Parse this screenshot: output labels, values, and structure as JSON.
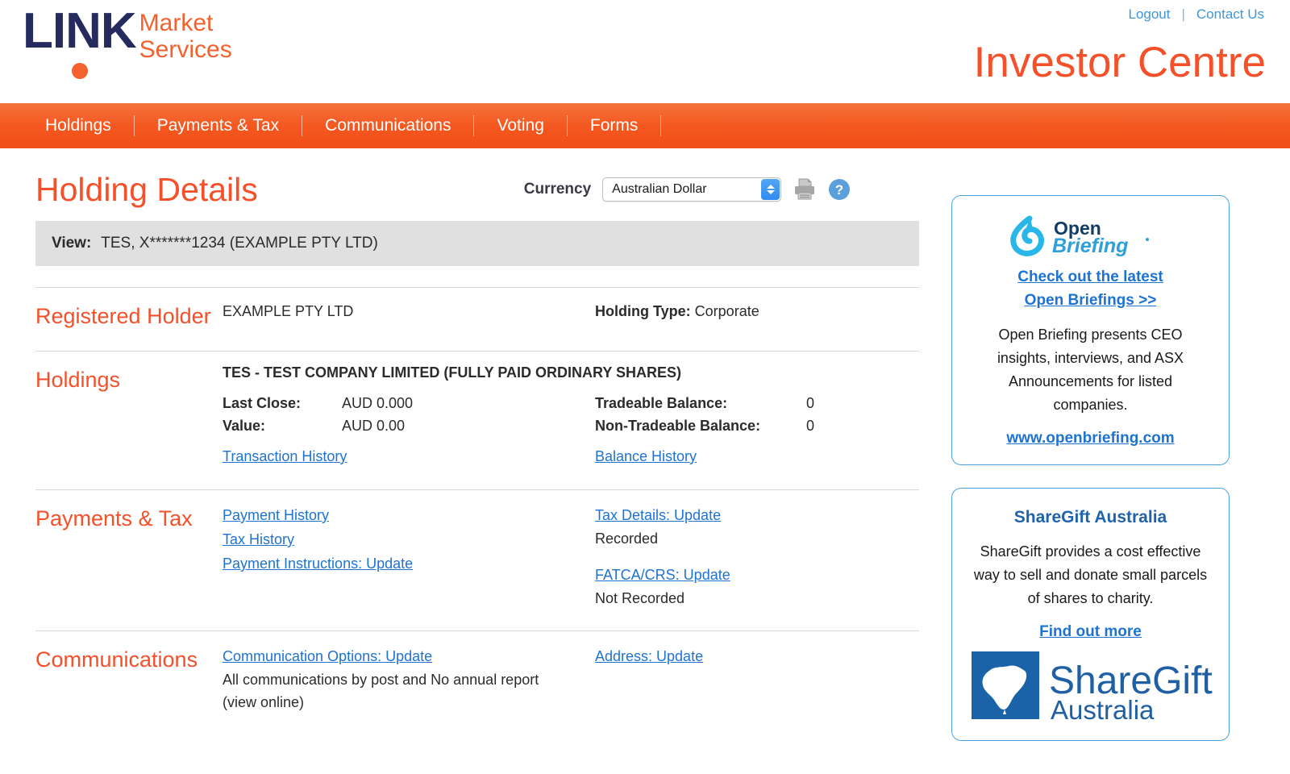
{
  "header": {
    "logo": {
      "brand": "LINK",
      "line1": "Market",
      "line2": "Services"
    },
    "logout": "Logout",
    "divider": "|",
    "contact_us": "Contact Us",
    "site_title": "Investor Centre"
  },
  "nav": {
    "items": [
      {
        "label": "Holdings"
      },
      {
        "label": "Payments & Tax"
      },
      {
        "label": "Communications"
      },
      {
        "label": "Voting"
      },
      {
        "label": "Forms"
      }
    ]
  },
  "toolbar": {
    "page_title": "Holding Details",
    "currency_label": "Currency",
    "currency_value": "Australian Dollar",
    "print_icon": "printer-icon",
    "help_icon": "help-icon"
  },
  "view_bar": {
    "label": "View:",
    "value": "TES, X*******1234 (EXAMPLE PTY LTD)"
  },
  "registered_holder": {
    "section_label": "Registered Holder",
    "holder_name": "EXAMPLE PTY LTD",
    "holding_type_label": "Holding Type:",
    "holding_type_value": "Corporate"
  },
  "holdings": {
    "section_label": "Holdings",
    "security_title": "TES - TEST COMPANY LIMITED (FULLY PAID ORDINARY SHARES)",
    "last_close_label": "Last Close:",
    "last_close_value": "AUD 0.000",
    "value_label": "Value:",
    "value_value": "AUD 0.00",
    "tradeable_label": "Tradeable Balance:",
    "tradeable_value": "0",
    "non_tradeable_label": "Non-Tradeable Balance:",
    "non_tradeable_value": "0",
    "transaction_history_link": "Transaction History",
    "balance_history_link": "Balance History"
  },
  "payments_tax": {
    "section_label": "Payments & Tax",
    "payment_history_link": "Payment History",
    "tax_history_link": "Tax History",
    "payment_instructions_link": "Payment Instructions: Update",
    "tax_details_link": "Tax Details: Update",
    "tax_details_status": "Recorded",
    "fatca_link": "FATCA/CRS: Update",
    "fatca_status": "Not Recorded"
  },
  "communications": {
    "section_label": "Communications",
    "communication_options_link": "Communication Options: Update",
    "communication_status_line1": "All communications by post and No annual report",
    "communication_status_line2": "(view online)",
    "address_link": "Address: Update"
  },
  "open_briefing_panel": {
    "logo_alt": "Open Briefing",
    "logo_word1": "Open",
    "logo_word2": "Briefing",
    "link_line1": "Check out the latest",
    "link_line2": "Open Briefings >>",
    "body": "Open Briefing presents CEO insights, interviews, and ASX Announcements for listed companies.",
    "website_link": "www.openbriefing.com"
  },
  "sharegift_panel": {
    "heading": "ShareGift Australia",
    "body": "ShareGift provides a cost effective way to sell and donate small parcels of shares to charity.",
    "find_out_more_link": "Find out more",
    "logo_word1": "ShareGift",
    "logo_word2": "Australia"
  },
  "colors": {
    "brand_orange": "#f4502a",
    "nav_orange": "#f4571f",
    "logo_navy": "#262b5f",
    "link_blue": "#1e73d2",
    "top_link_blue": "#3f96d9",
    "panel_border_blue": "#4aa3e0",
    "view_bar_gray": "#e0e0e0"
  }
}
